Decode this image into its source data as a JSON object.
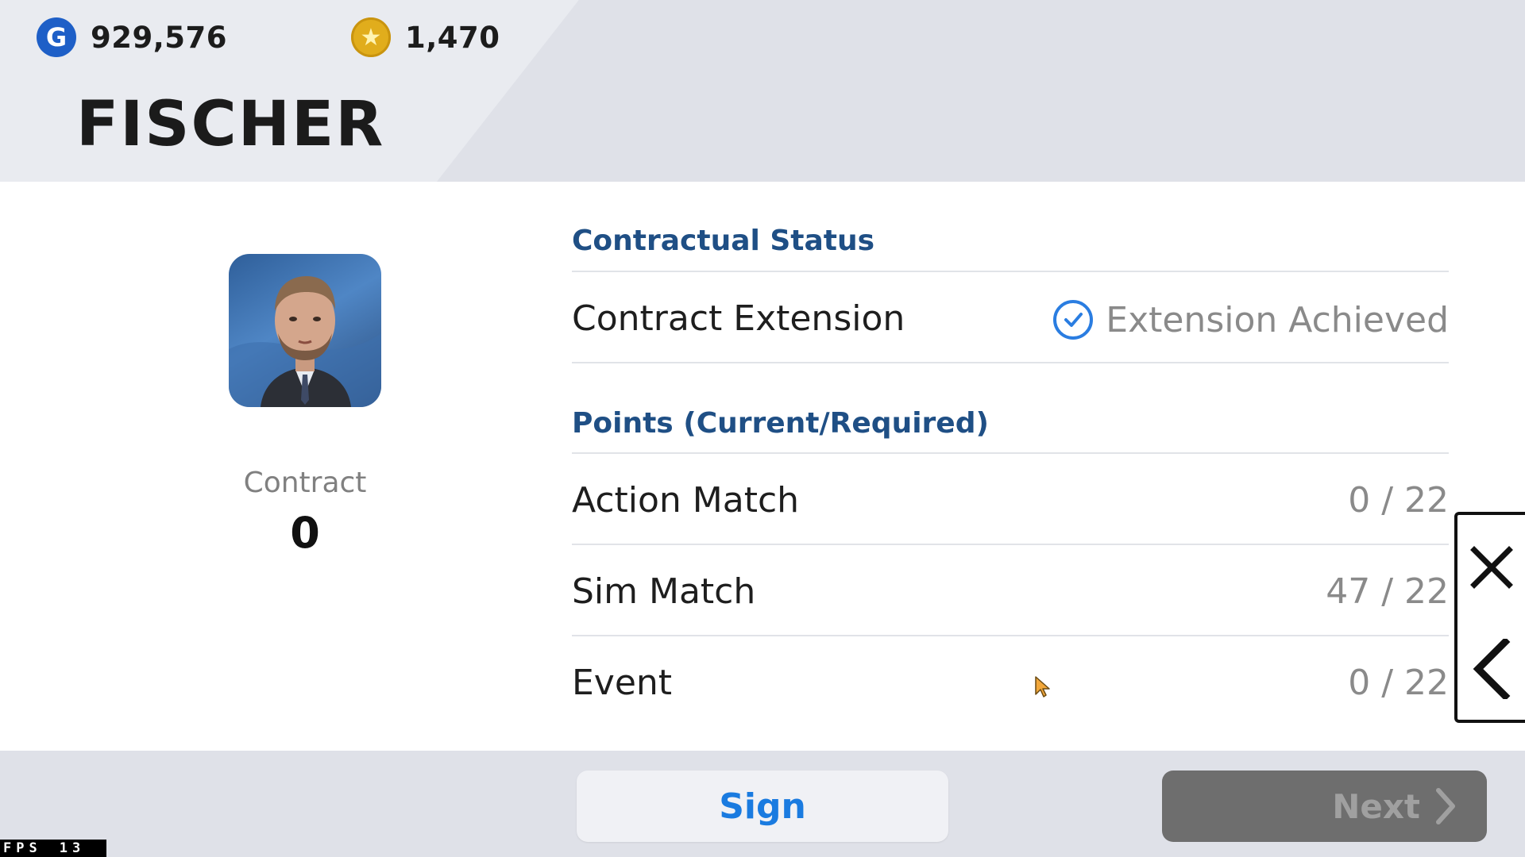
{
  "header": {
    "gp_amount": "929,576",
    "coin_amount": "1,470",
    "manager_name": "FISCHER"
  },
  "profile": {
    "contract_label": "Contract",
    "contract_value": "0"
  },
  "contractual_status": {
    "heading": "Contractual Status",
    "row_label": "Contract Extension",
    "status_text": "Extension Achieved"
  },
  "points": {
    "heading": "Points (Current/Required)",
    "rows": [
      {
        "label": "Action Match",
        "value": "0 / 22"
      },
      {
        "label": "Sim Match",
        "value": "47 / 22"
      },
      {
        "label": "Event",
        "value": "0 / 22"
      }
    ]
  },
  "footer": {
    "sign_label": "Sign",
    "next_label": "Next"
  },
  "overlay": {
    "fps_label": "FPS",
    "fps_value": "13"
  },
  "icons": {
    "gp": "gp-currency-icon",
    "coin": "coin-currency-icon",
    "status": "check-circle-icon",
    "close": "close-icon",
    "back": "chevron-left-icon",
    "next": "chevron-right-icon"
  },
  "colors": {
    "accent_blue": "#1a7be0",
    "heading_blue": "#1f4f85",
    "header_bg": "#dfe1e8",
    "disabled_button": "#6e6e6e"
  }
}
